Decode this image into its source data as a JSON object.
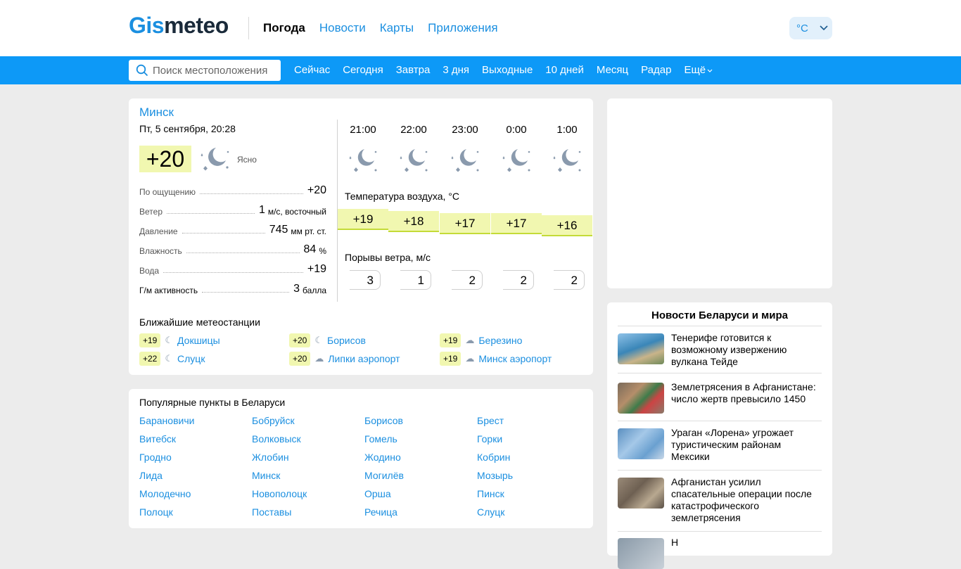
{
  "header": {
    "logo_part1": "Gis",
    "logo_part2": "meteo",
    "nav": [
      "Погода",
      "Новости",
      "Карты",
      "Приложения"
    ],
    "unit": "°C"
  },
  "search": {
    "placeholder": "Поиск местоположения"
  },
  "subnav": [
    "Сейчас",
    "Сегодня",
    "Завтра",
    "3 дня",
    "Выходные",
    "10 дней",
    "Месяц",
    "Радар",
    "Ещё"
  ],
  "current": {
    "city": "Минск",
    "datetime": "Пт, 5 сентября, 20:28",
    "temp": "+20",
    "condition": "Ясно",
    "details": [
      {
        "label": "По ощущению",
        "value": "+20",
        "unit": ""
      },
      {
        "label": "Ветер",
        "value": "1",
        "unit": "м/с, восточный"
      },
      {
        "label": "Давление",
        "value": "745",
        "unit": "мм рт. ст."
      },
      {
        "label": "Влажность",
        "value": "84",
        "unit": "%"
      },
      {
        "label": "Вода",
        "value": "+19",
        "unit": ""
      },
      {
        "label": "Г/м активность",
        "value": "3",
        "unit": "балла"
      }
    ]
  },
  "hourly": {
    "times": [
      "21:00",
      "22:00",
      "23:00",
      "0:00",
      "1:00"
    ],
    "air_label": "Температура воздуха, °C",
    "temps": [
      "+19",
      "+18",
      "+17",
      "+17",
      "+16"
    ],
    "temp_values": [
      19,
      18,
      17,
      17,
      16
    ],
    "gust_label": "Порывы ветра, м/с",
    "gusts": [
      "3",
      "1",
      "2",
      "2",
      "2"
    ]
  },
  "stations": {
    "label": "Ближайшие метеостанции",
    "items": [
      {
        "temp": "+19",
        "name": "Докшицы"
      },
      {
        "temp": "+20",
        "name": "Борисов"
      },
      {
        "temp": "+19",
        "name": "Березино"
      },
      {
        "temp": "+22",
        "name": "Слуцк"
      },
      {
        "temp": "+20",
        "name": "Липки аэропорт"
      },
      {
        "temp": "+19",
        "name": "Минск аэропорт"
      }
    ]
  },
  "popular": {
    "label": "Популярные пункты в Беларуси",
    "cols": [
      [
        "Барановичи",
        "Витебск",
        "Гродно",
        "Лида",
        "Молодечно",
        "Полоцк"
      ],
      [
        "Бобруйск",
        "Волковыск",
        "Жлобин",
        "Минск",
        "Новополоцк",
        "Поставы"
      ],
      [
        "Борисов",
        "Гомель",
        "Жодино",
        "Могилёв",
        "Орша",
        "Речица"
      ],
      [
        "Брест",
        "Горки",
        "Кобрин",
        "Мозырь",
        "Пинск",
        "Слуцк"
      ]
    ]
  },
  "news": {
    "title": "Новости Беларуси и мира",
    "items": [
      "Тенерифе готовится к возможному извержению вулкана Тейде",
      "Землетрясения в Афганистане: число жертв превысило 1450",
      "Ураган «Лорена» угрожает туристическим районам Мексики",
      "Афганистан усилил спасательные операции после катастрофического землетрясения",
      "Н"
    ]
  }
}
